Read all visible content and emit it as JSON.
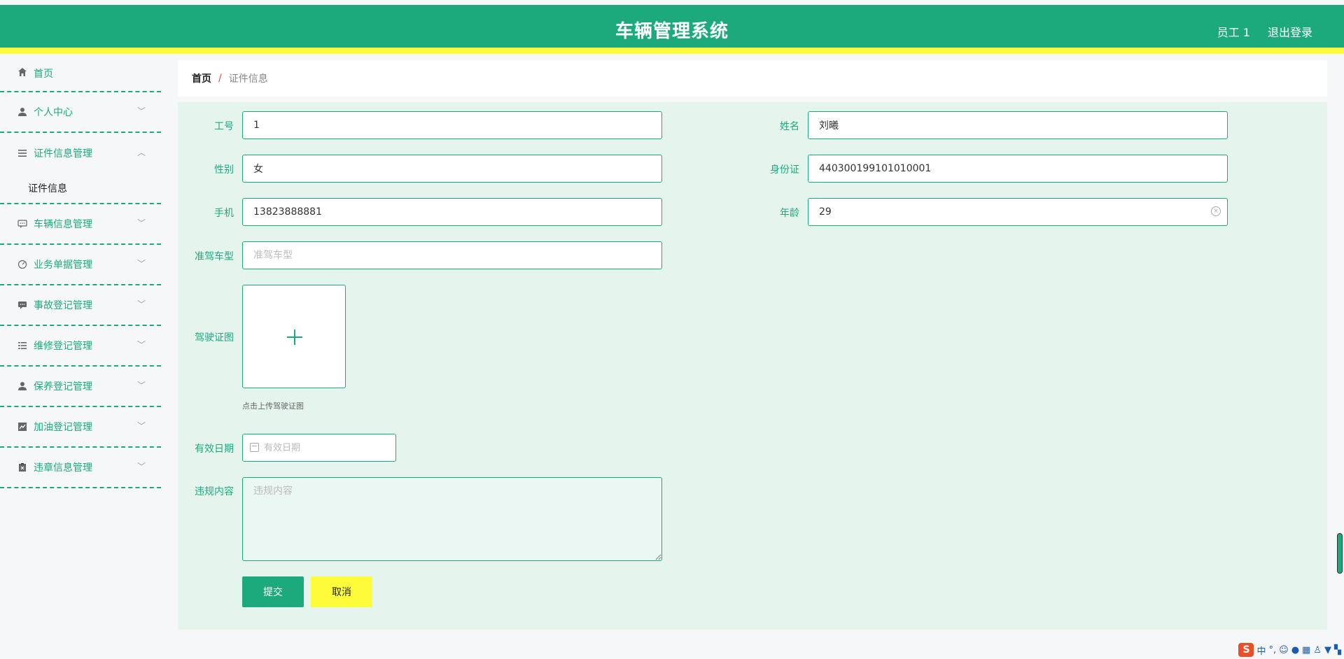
{
  "header": {
    "title": "车辆管理系统",
    "user": "员工 1",
    "logout": "退出登录"
  },
  "sidebar": {
    "items": [
      {
        "label": "首页",
        "icon": "home-icon"
      },
      {
        "label": "个人中心",
        "icon": "user-icon"
      },
      {
        "label": "证件信息管理",
        "icon": "menu-icon",
        "expanded": true,
        "children": [
          "证件信息"
        ]
      },
      {
        "label": "车辆信息管理",
        "icon": "chat-icon"
      },
      {
        "label": "业务单据管理",
        "icon": "gauge-icon"
      },
      {
        "label": "事故登记管理",
        "icon": "message-icon"
      },
      {
        "label": "维修登记管理",
        "icon": "list-icon"
      },
      {
        "label": "保养登记管理",
        "icon": "user-icon"
      },
      {
        "label": "加油登记管理",
        "icon": "chart-icon"
      },
      {
        "label": "违章信息管理",
        "icon": "clipboard-icon"
      }
    ]
  },
  "breadcrumb": {
    "home": "首页",
    "separator": "/",
    "current": "证件信息"
  },
  "form": {
    "gonghao": {
      "label": "工号",
      "value": "1"
    },
    "xingming": {
      "label": "姓名",
      "value": "刘曦"
    },
    "xingbie": {
      "label": "性别",
      "value": "女"
    },
    "shenfenzheng": {
      "label": "身份证",
      "value": "440300199101010001"
    },
    "shouji": {
      "label": "手机",
      "value": "13823888881"
    },
    "nianling": {
      "label": "年龄",
      "value": "29"
    },
    "zhunjia": {
      "label": "准驾车型",
      "value": "",
      "placeholder": "准驾车型"
    },
    "jiashizheng": {
      "label": "驾驶证图",
      "hint": "点击上传驾驶证图"
    },
    "youxiao": {
      "label": "有效日期",
      "placeholder": "有效日期"
    },
    "weigui": {
      "label": "违规内容",
      "placeholder": "违规内容"
    },
    "submit": "提交",
    "cancel": "取消"
  },
  "colors": {
    "primary": "#1caa7d",
    "accent_yellow": "#fdfb3a",
    "content_bg": "#e5f5ee"
  }
}
